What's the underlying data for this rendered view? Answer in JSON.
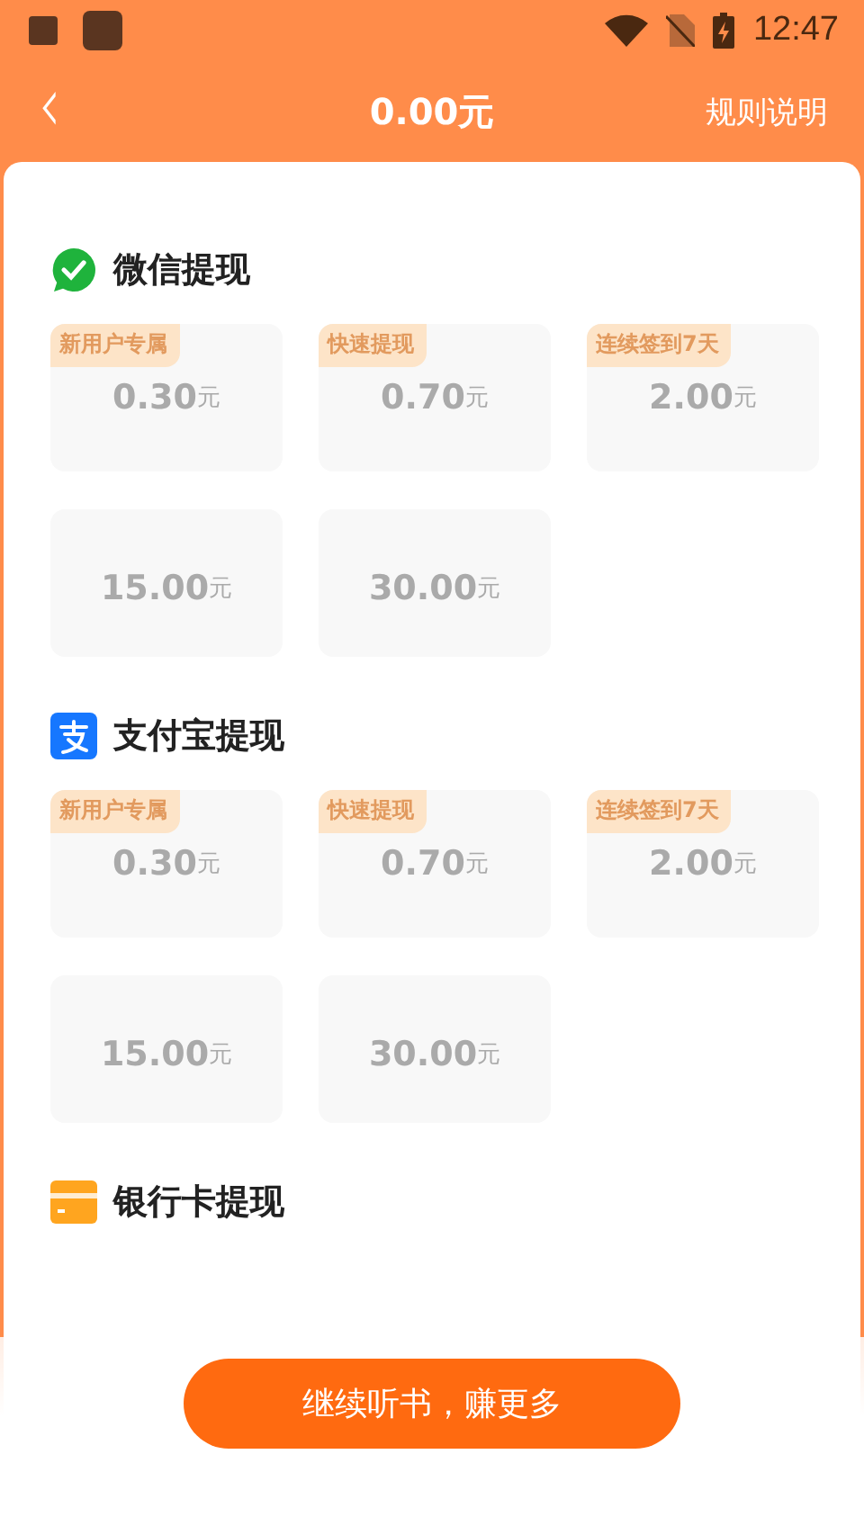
{
  "status_bar": {
    "time": "12:47"
  },
  "header": {
    "back": "‹",
    "title": "0.00元",
    "rules_link": "规则说明"
  },
  "sections": [
    {
      "kind": "wechat",
      "title": "微信提现",
      "options": [
        {
          "badge": "新用户专属",
          "amount": "0.30",
          "unit": "元"
        },
        {
          "badge": "快速提现",
          "amount": "0.70",
          "unit": "元"
        },
        {
          "badge": "连续签到7天",
          "amount": "2.00",
          "unit": "元"
        },
        {
          "amount": "15.00",
          "unit": "元"
        },
        {
          "amount": "30.00",
          "unit": "元"
        }
      ]
    },
    {
      "kind": "alipay",
      "title": "支付宝提现",
      "options": [
        {
          "badge": "新用户专属",
          "amount": "0.30",
          "unit": "元"
        },
        {
          "badge": "快速提现",
          "amount": "0.70",
          "unit": "元"
        },
        {
          "badge": "连续签到7天",
          "amount": "2.00",
          "unit": "元"
        },
        {
          "amount": "15.00",
          "unit": "元"
        },
        {
          "amount": "30.00",
          "unit": "元"
        }
      ]
    },
    {
      "kind": "bank",
      "title": "银行卡提现"
    }
  ],
  "action_button": "继续听书，赚更多"
}
